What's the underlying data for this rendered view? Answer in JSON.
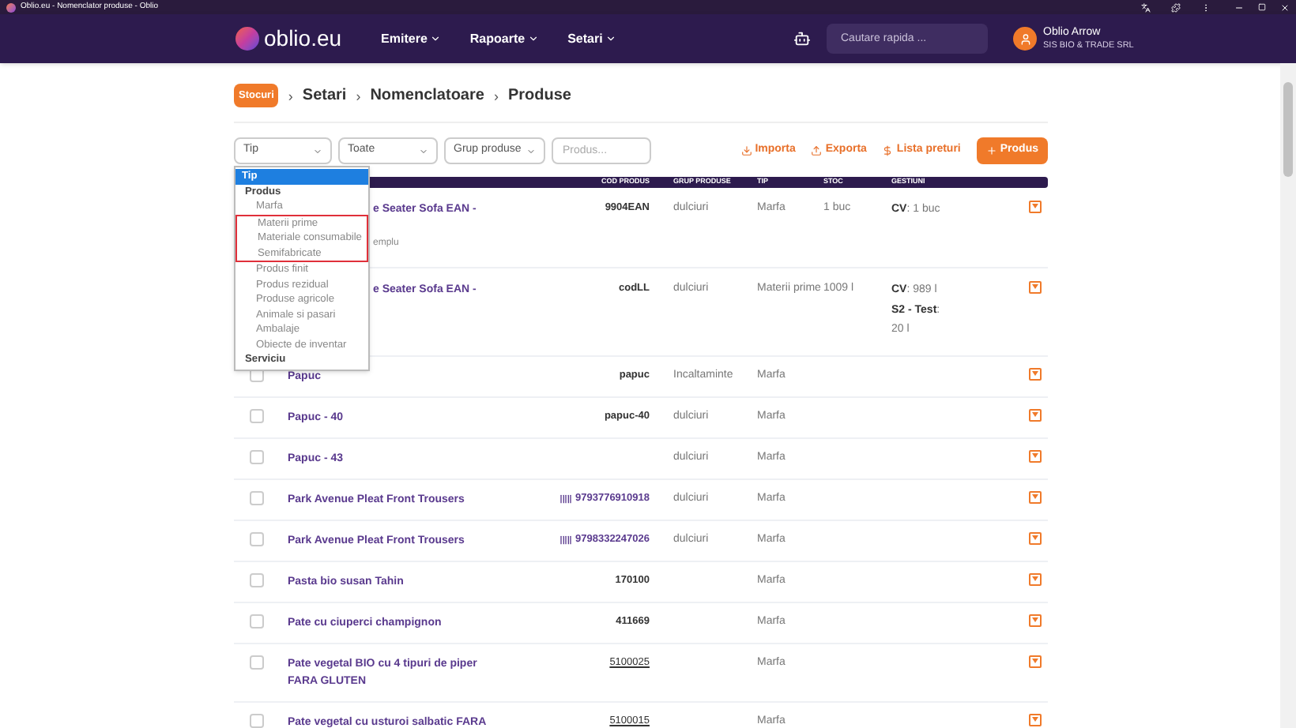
{
  "window": {
    "title": "Oblio.eu - Nomenclator produse - Oblio"
  },
  "nav": {
    "logo": "oblio.eu",
    "menus": [
      "Emitere",
      "Rapoarte",
      "Setari"
    ],
    "search": {
      "placeholder": "Cautare rapida ..."
    },
    "user": {
      "name": "Oblio Arrow",
      "company": "SIS BIO & TRADE SRL"
    }
  },
  "breadcrumb": {
    "badge": "Stocuri",
    "items": [
      {
        "separator": "›",
        "label": "Setari"
      },
      {
        "separator": "›",
        "label": "Nomenclatoare"
      },
      {
        "separator": "›",
        "label": "Produse"
      }
    ]
  },
  "filters": {
    "type_select": "Tip",
    "scope_select": "Toate",
    "group_select": "Grup produse",
    "search": {
      "placeholder": "Produs..."
    }
  },
  "actions": [
    "Importa",
    "Exporta",
    "Lista preturi"
  ],
  "add_button": "Produs",
  "type_dropdown": [
    {
      "label": "Tip",
      "kind": "header",
      "selected": true,
      "highlighted": false
    },
    {
      "label": "Produs",
      "kind": "group",
      "selected": false,
      "highlighted": false
    },
    {
      "label": "Marfa",
      "kind": "option",
      "selected": false,
      "highlighted": false
    },
    {
      "label": "Materii prime",
      "kind": "option",
      "selected": false,
      "highlighted": true
    },
    {
      "label": "Materiale consumabile",
      "kind": "option",
      "selected": false,
      "highlighted": true
    },
    {
      "label": "Semifabricate",
      "kind": "option",
      "selected": false,
      "highlighted": true
    },
    {
      "label": "Produs finit",
      "kind": "option",
      "selected": false,
      "highlighted": false
    },
    {
      "label": "Produs rezidual",
      "kind": "option",
      "selected": false,
      "highlighted": false
    },
    {
      "label": "Produse agricole",
      "kind": "option",
      "selected": false,
      "highlighted": false
    },
    {
      "label": "Animale si pasari",
      "kind": "option",
      "selected": false,
      "highlighted": false
    },
    {
      "label": "Ambalaje",
      "kind": "option",
      "selected": false,
      "highlighted": false
    },
    {
      "label": "Obiecte de inventar",
      "kind": "option",
      "selected": false,
      "highlighted": false
    },
    {
      "label": "Serviciu",
      "kind": "group",
      "selected": false,
      "highlighted": false
    }
  ],
  "table": {
    "columns": [
      "COD PRODUS",
      "GRUP PRODUSE",
      "TIP",
      "STOC",
      "GESTIUNI"
    ],
    "rows": [
      {
        "covered": true,
        "name": "e Seater Sofa EAN -",
        "note": "emplu",
        "code": "9904EAN",
        "barcode": false,
        "underlined": false,
        "group": "dulciuri",
        "type": "Marfa",
        "stock": "1 buc",
        "stores": [
          "**CV**: 1 buc"
        ]
      },
      {
        "covered": true,
        "name": "e Seater Sofa EAN -",
        "code": "codLL",
        "barcode": false,
        "underlined": false,
        "group": "dulciuri",
        "type": "Materii prime",
        "stock": "1009 l",
        "stores": [
          "**CV**: 989 l",
          "**S2 - Test**: 20 l"
        ]
      },
      {
        "covered": false,
        "checked": false,
        "name": "Papuc",
        "code": "papuc",
        "barcode": false,
        "underlined": false,
        "group": "Incaltaminte",
        "type": "Marfa"
      },
      {
        "covered": false,
        "checked": false,
        "name": "Papuc - 40",
        "code": "papuc-40",
        "barcode": false,
        "underlined": false,
        "group": "dulciuri",
        "type": "Marfa"
      },
      {
        "covered": false,
        "checked": false,
        "name": "Papuc - 43",
        "group": "dulciuri",
        "type": "Marfa"
      },
      {
        "covered": false,
        "checked": false,
        "name": "Park Avenue Pleat Front Trousers",
        "code": "9793776910918",
        "barcode": true,
        "underlined": false,
        "group": "dulciuri",
        "type": "Marfa"
      },
      {
        "covered": false,
        "checked": false,
        "name": "Park Avenue Pleat Front Trousers",
        "code": "9798332247026",
        "barcode": true,
        "underlined": false,
        "group": "dulciuri",
        "type": "Marfa"
      },
      {
        "covered": false,
        "checked": false,
        "name": "Pasta bio susan Tahin",
        "code": "170100",
        "barcode": false,
        "underlined": false,
        "type": "Marfa"
      },
      {
        "covered": false,
        "checked": false,
        "name": "Pate cu ciuperci champignon",
        "code": "411669",
        "barcode": false,
        "underlined": false,
        "type": "Marfa"
      },
      {
        "covered": false,
        "checked": false,
        "name": "Pate vegetal BIO cu 4 tipuri de piper FARA GLUTEN",
        "code": "5100025",
        "barcode": false,
        "underlined": true,
        "type": "Marfa"
      },
      {
        "covered": false,
        "checked": false,
        "name": "Pate vegetal cu usturoi salbatic FARA",
        "code": "5100015",
        "barcode": false,
        "underlined": true,
        "type": "Marfa"
      }
    ]
  }
}
